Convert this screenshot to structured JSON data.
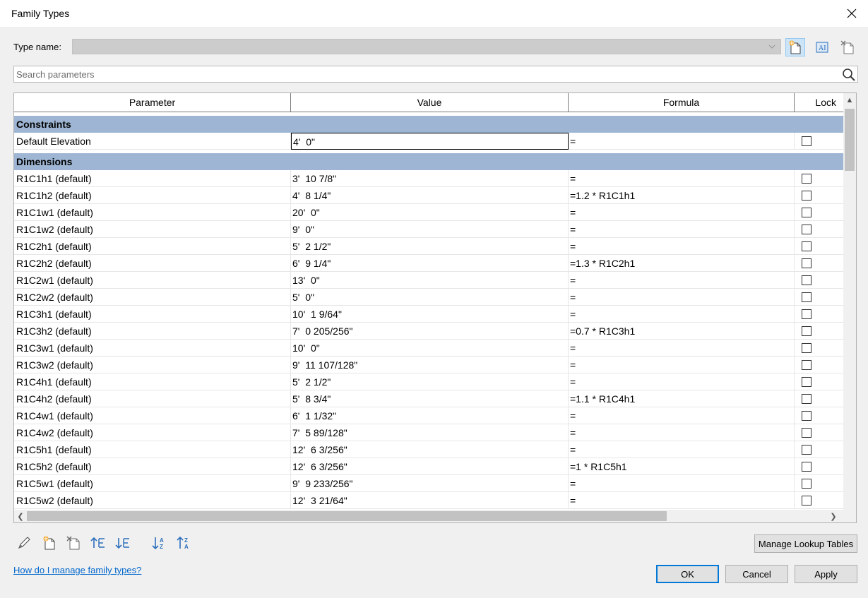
{
  "window": {
    "title": "Family Types"
  },
  "type_name": {
    "label": "Type name:",
    "value": ""
  },
  "search": {
    "placeholder": "Search parameters"
  },
  "table": {
    "headers": [
      "Parameter",
      "Value",
      "Formula",
      "Lock"
    ],
    "groups": [
      {
        "name": "Constraints",
        "rows": [
          {
            "param": "Default Elevation",
            "value": "4'  0\"",
            "formula": "=",
            "lock": false,
            "selected": true
          }
        ]
      },
      {
        "name": "Dimensions",
        "rows": [
          {
            "param": "R1C1h1 (default)",
            "value": "3'  10 7/8\"",
            "formula": "=",
            "lock": false
          },
          {
            "param": "R1C1h2 (default)",
            "value": "4'  8 1/4\"",
            "formula": "=1.2 * R1C1h1",
            "lock": false
          },
          {
            "param": "R1C1w1 (default)",
            "value": "20'  0\"",
            "formula": "=",
            "lock": false
          },
          {
            "param": "R1C1w2 (default)",
            "value": "9'  0\"",
            "formula": "=",
            "lock": false
          },
          {
            "param": "R1C2h1 (default)",
            "value": "5'  2 1/2\"",
            "formula": "=",
            "lock": false
          },
          {
            "param": "R1C2h2 (default)",
            "value": "6'  9 1/4\"",
            "formula": "=1.3 * R1C2h1",
            "lock": false
          },
          {
            "param": "R1C2w1 (default)",
            "value": "13'  0\"",
            "formula": "=",
            "lock": false
          },
          {
            "param": "R1C2w2 (default)",
            "value": "5'  0\"",
            "formula": "=",
            "lock": false
          },
          {
            "param": "R1C3h1 (default)",
            "value": "10'  1 9/64\"",
            "formula": "=",
            "lock": false
          },
          {
            "param": "R1C3h2 (default)",
            "value": "7'  0 205/256\"",
            "formula": "=0.7 * R1C3h1",
            "lock": false
          },
          {
            "param": "R1C3w1 (default)",
            "value": "10'  0\"",
            "formula": "=",
            "lock": false
          },
          {
            "param": "R1C3w2 (default)",
            "value": "9'  11 107/128\"",
            "formula": "=",
            "lock": false
          },
          {
            "param": "R1C4h1 (default)",
            "value": "5'  2 1/2\"",
            "formula": "=",
            "lock": false
          },
          {
            "param": "R1C4h2 (default)",
            "value": "5'  8 3/4\"",
            "formula": "=1.1 * R1C4h1",
            "lock": false
          },
          {
            "param": "R1C4w1 (default)",
            "value": "6'  1 1/32\"",
            "formula": "=",
            "lock": false
          },
          {
            "param": "R1C4w2 (default)",
            "value": "7'  5 89/128\"",
            "formula": "=",
            "lock": false
          },
          {
            "param": "R1C5h1 (default)",
            "value": "12'  6 3/256\"",
            "formula": "=",
            "lock": false
          },
          {
            "param": "R1C5h2 (default)",
            "value": "12'  6 3/256\"",
            "formula": "=1 * R1C5h1",
            "lock": false
          },
          {
            "param": "R1C5w1 (default)",
            "value": "9'  9 233/256\"",
            "formula": "=",
            "lock": false
          },
          {
            "param": "R1C5w2 (default)",
            "value": "12'  3 21/64\"",
            "formula": "=",
            "lock": false
          }
        ]
      }
    ]
  },
  "buttons": {
    "manage_lookup": "Manage Lookup Tables",
    "ok": "OK",
    "cancel": "Cancel",
    "apply": "Apply"
  },
  "help_link": "How do I manage family types?",
  "colors": {
    "group_header": "#9eb6d3",
    "accent": "#0078d7",
    "link": "#0066cc"
  }
}
